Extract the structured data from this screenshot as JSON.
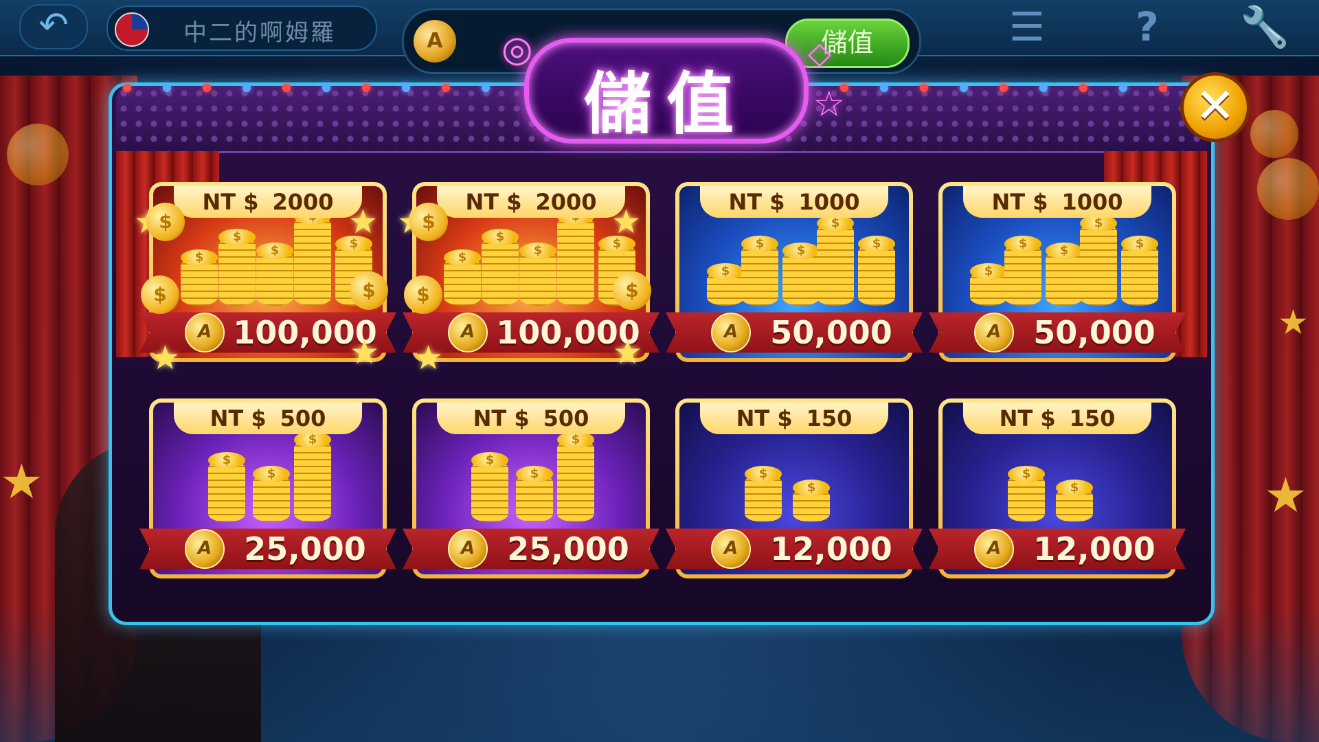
{
  "topbar": {
    "username": "中二的啊姆羅",
    "balance_hidden": "",
    "topup_label": "儲值",
    "back_icon": "back-arrow-icon",
    "notes_icon": "clipboard-icon",
    "help_icon": "question-icon",
    "settings_icon": "wrench-icon"
  },
  "modal": {
    "title": "儲值",
    "close_label": "✕"
  },
  "packages": [
    {
      "currency": "NT $",
      "price": "2000",
      "amount": "100,000",
      "tier": "red"
    },
    {
      "currency": "NT $",
      "price": "2000",
      "amount": "100,000",
      "tier": "red"
    },
    {
      "currency": "NT $",
      "price": "1000",
      "amount": "50,000",
      "tier": "blue"
    },
    {
      "currency": "NT $",
      "price": "1000",
      "amount": "50,000",
      "tier": "blue"
    },
    {
      "currency": "NT $",
      "price": "500",
      "amount": "25,000",
      "tier": "purple"
    },
    {
      "currency": "NT $",
      "price": "500",
      "amount": "25,000",
      "tier": "purple"
    },
    {
      "currency": "NT $",
      "price": "150",
      "amount": "12,000",
      "tier": "navy"
    },
    {
      "currency": "NT $",
      "price": "150",
      "amount": "12,000",
      "tier": "navy"
    }
  ],
  "colors": {
    "modal_border": "#38c3ee",
    "title_neon": "#e45cf0",
    "ribbon_red": "#c0272d",
    "gold": "#f4b33a",
    "topup_green": "#238a15"
  }
}
